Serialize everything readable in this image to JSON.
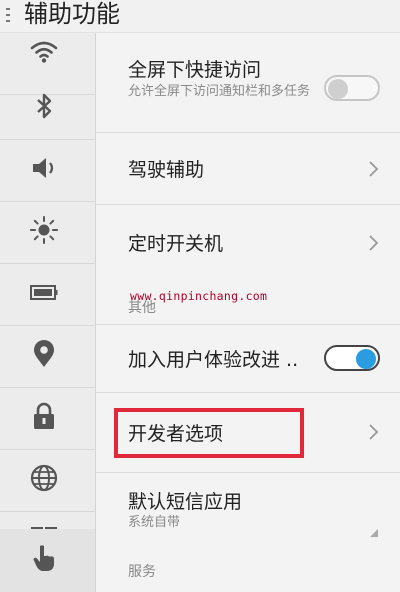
{
  "header": {
    "title": "辅助功能"
  },
  "sidebar": {
    "items": [
      {
        "icon": "wifi-icon"
      },
      {
        "icon": "bluetooth-icon"
      },
      {
        "icon": "volume-icon"
      },
      {
        "icon": "brightness-icon"
      },
      {
        "icon": "battery-icon"
      },
      {
        "icon": "location-icon"
      },
      {
        "icon": "lock-icon"
      },
      {
        "icon": "globe-icon"
      },
      {
        "icon": "grid-icon"
      },
      {
        "icon": "hand-pointer-icon"
      }
    ]
  },
  "settings": {
    "fullscreen_shortcut": {
      "title": "全屏下快捷访问",
      "subtitle": "允许全屏下访问通知栏和多任务",
      "enabled": false
    },
    "driving_assist": {
      "title": "驾驶辅助"
    },
    "scheduled_power": {
      "title": "定时开关机"
    },
    "other_section": {
      "label": "其他"
    },
    "user_experience": {
      "title": "加入用户体验改进 ..",
      "enabled": true
    },
    "developer_options": {
      "title": "开发者选项"
    },
    "default_sms": {
      "title": "默认短信应用",
      "subtitle": "系统自带"
    },
    "service_section": {
      "label": "服务"
    }
  },
  "watermark": "www.qinpinchang.com",
  "colors": {
    "highlight": "#e0283a",
    "toggle_on": "#2a9de1"
  }
}
